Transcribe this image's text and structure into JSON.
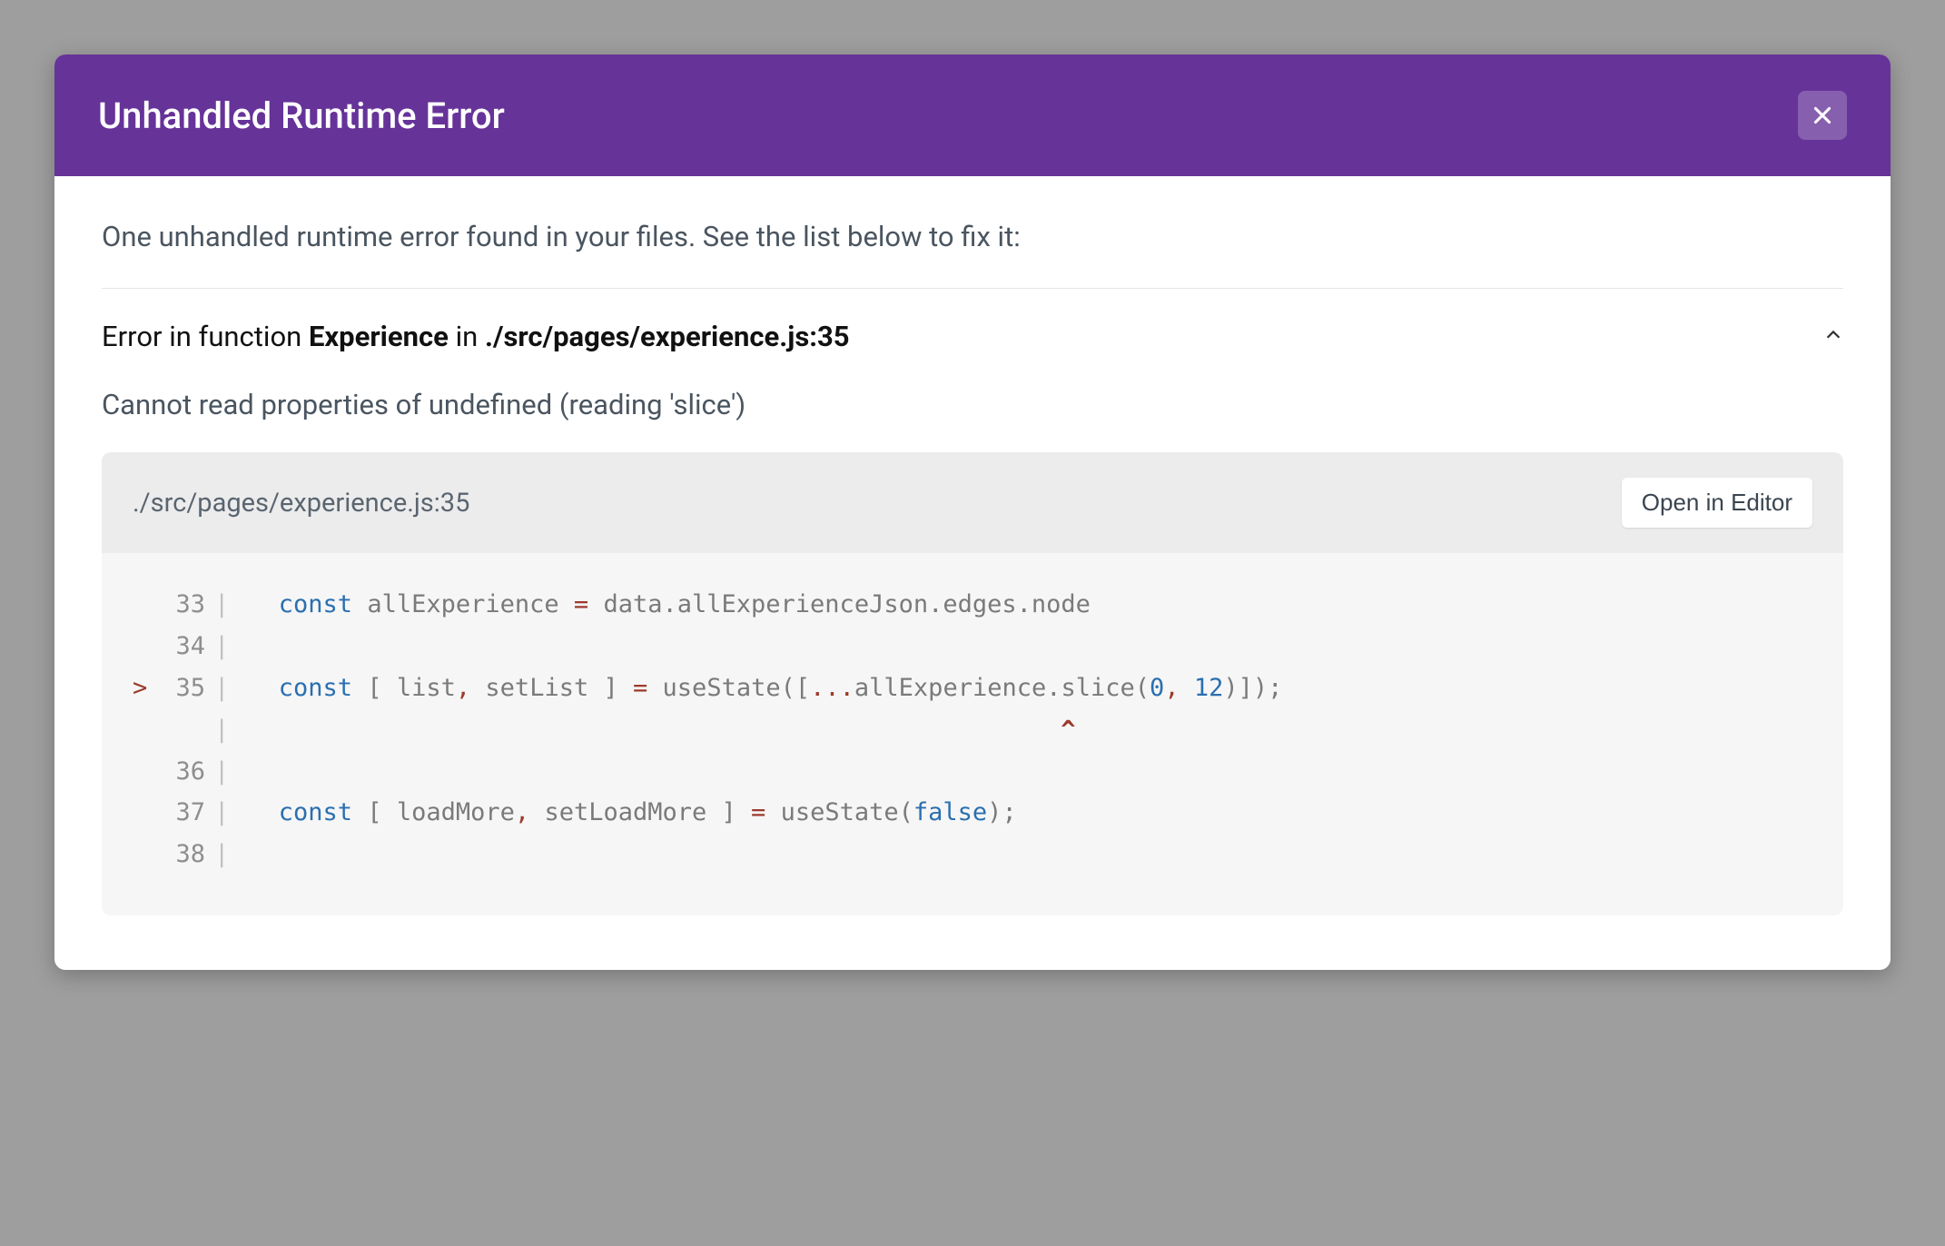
{
  "header": {
    "title": "Unhandled Runtime Error"
  },
  "intro": "One unhandled runtime error found in your files. See the list below to fix it:",
  "error": {
    "prefix": "Error in function ",
    "function_name": "Experience",
    "mid": " in ",
    "file_loc": "./src/pages/experience.js:35",
    "message": "Cannot read properties of undefined (reading 'slice')"
  },
  "file_bar": {
    "path": "./src/pages/experience.js:35",
    "open_label": "Open in Editor"
  },
  "code": {
    "lines": [
      {
        "marker": " ",
        "num": "33",
        "tokens": [
          {
            "t": "  ",
            "c": ""
          },
          {
            "t": "const",
            "c": "keyword"
          },
          {
            "t": " ",
            "c": ""
          },
          {
            "t": "allExperience",
            "c": "ident"
          },
          {
            "t": " ",
            "c": ""
          },
          {
            "t": "=",
            "c": "equals"
          },
          {
            "t": " ",
            "c": ""
          },
          {
            "t": "data",
            "c": "ident"
          },
          {
            "t": ".",
            "c": "punct"
          },
          {
            "t": "allExperienceJson",
            "c": "ident"
          },
          {
            "t": ".",
            "c": "punct"
          },
          {
            "t": "edges",
            "c": "ident"
          },
          {
            "t": ".",
            "c": "punct"
          },
          {
            "t": "node",
            "c": "ident"
          }
        ]
      },
      {
        "marker": " ",
        "num": "34",
        "tokens": []
      },
      {
        "marker": ">",
        "num": "35",
        "tokens": [
          {
            "t": "  ",
            "c": ""
          },
          {
            "t": "const",
            "c": "keyword"
          },
          {
            "t": " ",
            "c": ""
          },
          {
            "t": "[",
            "c": "punct"
          },
          {
            "t": " ",
            "c": ""
          },
          {
            "t": "list",
            "c": "ident"
          },
          {
            "t": ",",
            "c": "equals"
          },
          {
            "t": " ",
            "c": ""
          },
          {
            "t": "setList",
            "c": "ident"
          },
          {
            "t": " ",
            "c": ""
          },
          {
            "t": "]",
            "c": "punct"
          },
          {
            "t": " ",
            "c": ""
          },
          {
            "t": "=",
            "c": "equals"
          },
          {
            "t": " ",
            "c": ""
          },
          {
            "t": "useState",
            "c": "ident"
          },
          {
            "t": "(",
            "c": "punct"
          },
          {
            "t": "[",
            "c": "punct"
          },
          {
            "t": "...",
            "c": "equals"
          },
          {
            "t": "allExperience",
            "c": "ident"
          },
          {
            "t": ".",
            "c": "punct"
          },
          {
            "t": "slice",
            "c": "ident"
          },
          {
            "t": "(",
            "c": "punct"
          },
          {
            "t": "0",
            "c": "num"
          },
          {
            "t": ",",
            "c": "equals"
          },
          {
            "t": " ",
            "c": ""
          },
          {
            "t": "12",
            "c": "num"
          },
          {
            "t": ")",
            "c": "punct"
          },
          {
            "t": "]",
            "c": "punct"
          },
          {
            "t": ")",
            "c": "punct"
          },
          {
            "t": ";",
            "c": "punct"
          }
        ]
      },
      {
        "marker": " ",
        "num": "  ",
        "tokens": [
          {
            "t": "                                                       ^",
            "c": "caret"
          }
        ]
      },
      {
        "marker": " ",
        "num": "36",
        "tokens": []
      },
      {
        "marker": " ",
        "num": "37",
        "tokens": [
          {
            "t": "  ",
            "c": ""
          },
          {
            "t": "const",
            "c": "keyword"
          },
          {
            "t": " ",
            "c": ""
          },
          {
            "t": "[",
            "c": "punct"
          },
          {
            "t": " ",
            "c": ""
          },
          {
            "t": "loadMore",
            "c": "ident"
          },
          {
            "t": ",",
            "c": "equals"
          },
          {
            "t": " ",
            "c": ""
          },
          {
            "t": "setLoadMore",
            "c": "ident"
          },
          {
            "t": " ",
            "c": ""
          },
          {
            "t": "]",
            "c": "punct"
          },
          {
            "t": " ",
            "c": ""
          },
          {
            "t": "=",
            "c": "equals"
          },
          {
            "t": " ",
            "c": ""
          },
          {
            "t": "useState",
            "c": "ident"
          },
          {
            "t": "(",
            "c": "punct"
          },
          {
            "t": "false",
            "c": "bool"
          },
          {
            "t": ")",
            "c": "punct"
          },
          {
            "t": ";",
            "c": "punct"
          }
        ]
      },
      {
        "marker": " ",
        "num": "38",
        "tokens": []
      }
    ]
  }
}
